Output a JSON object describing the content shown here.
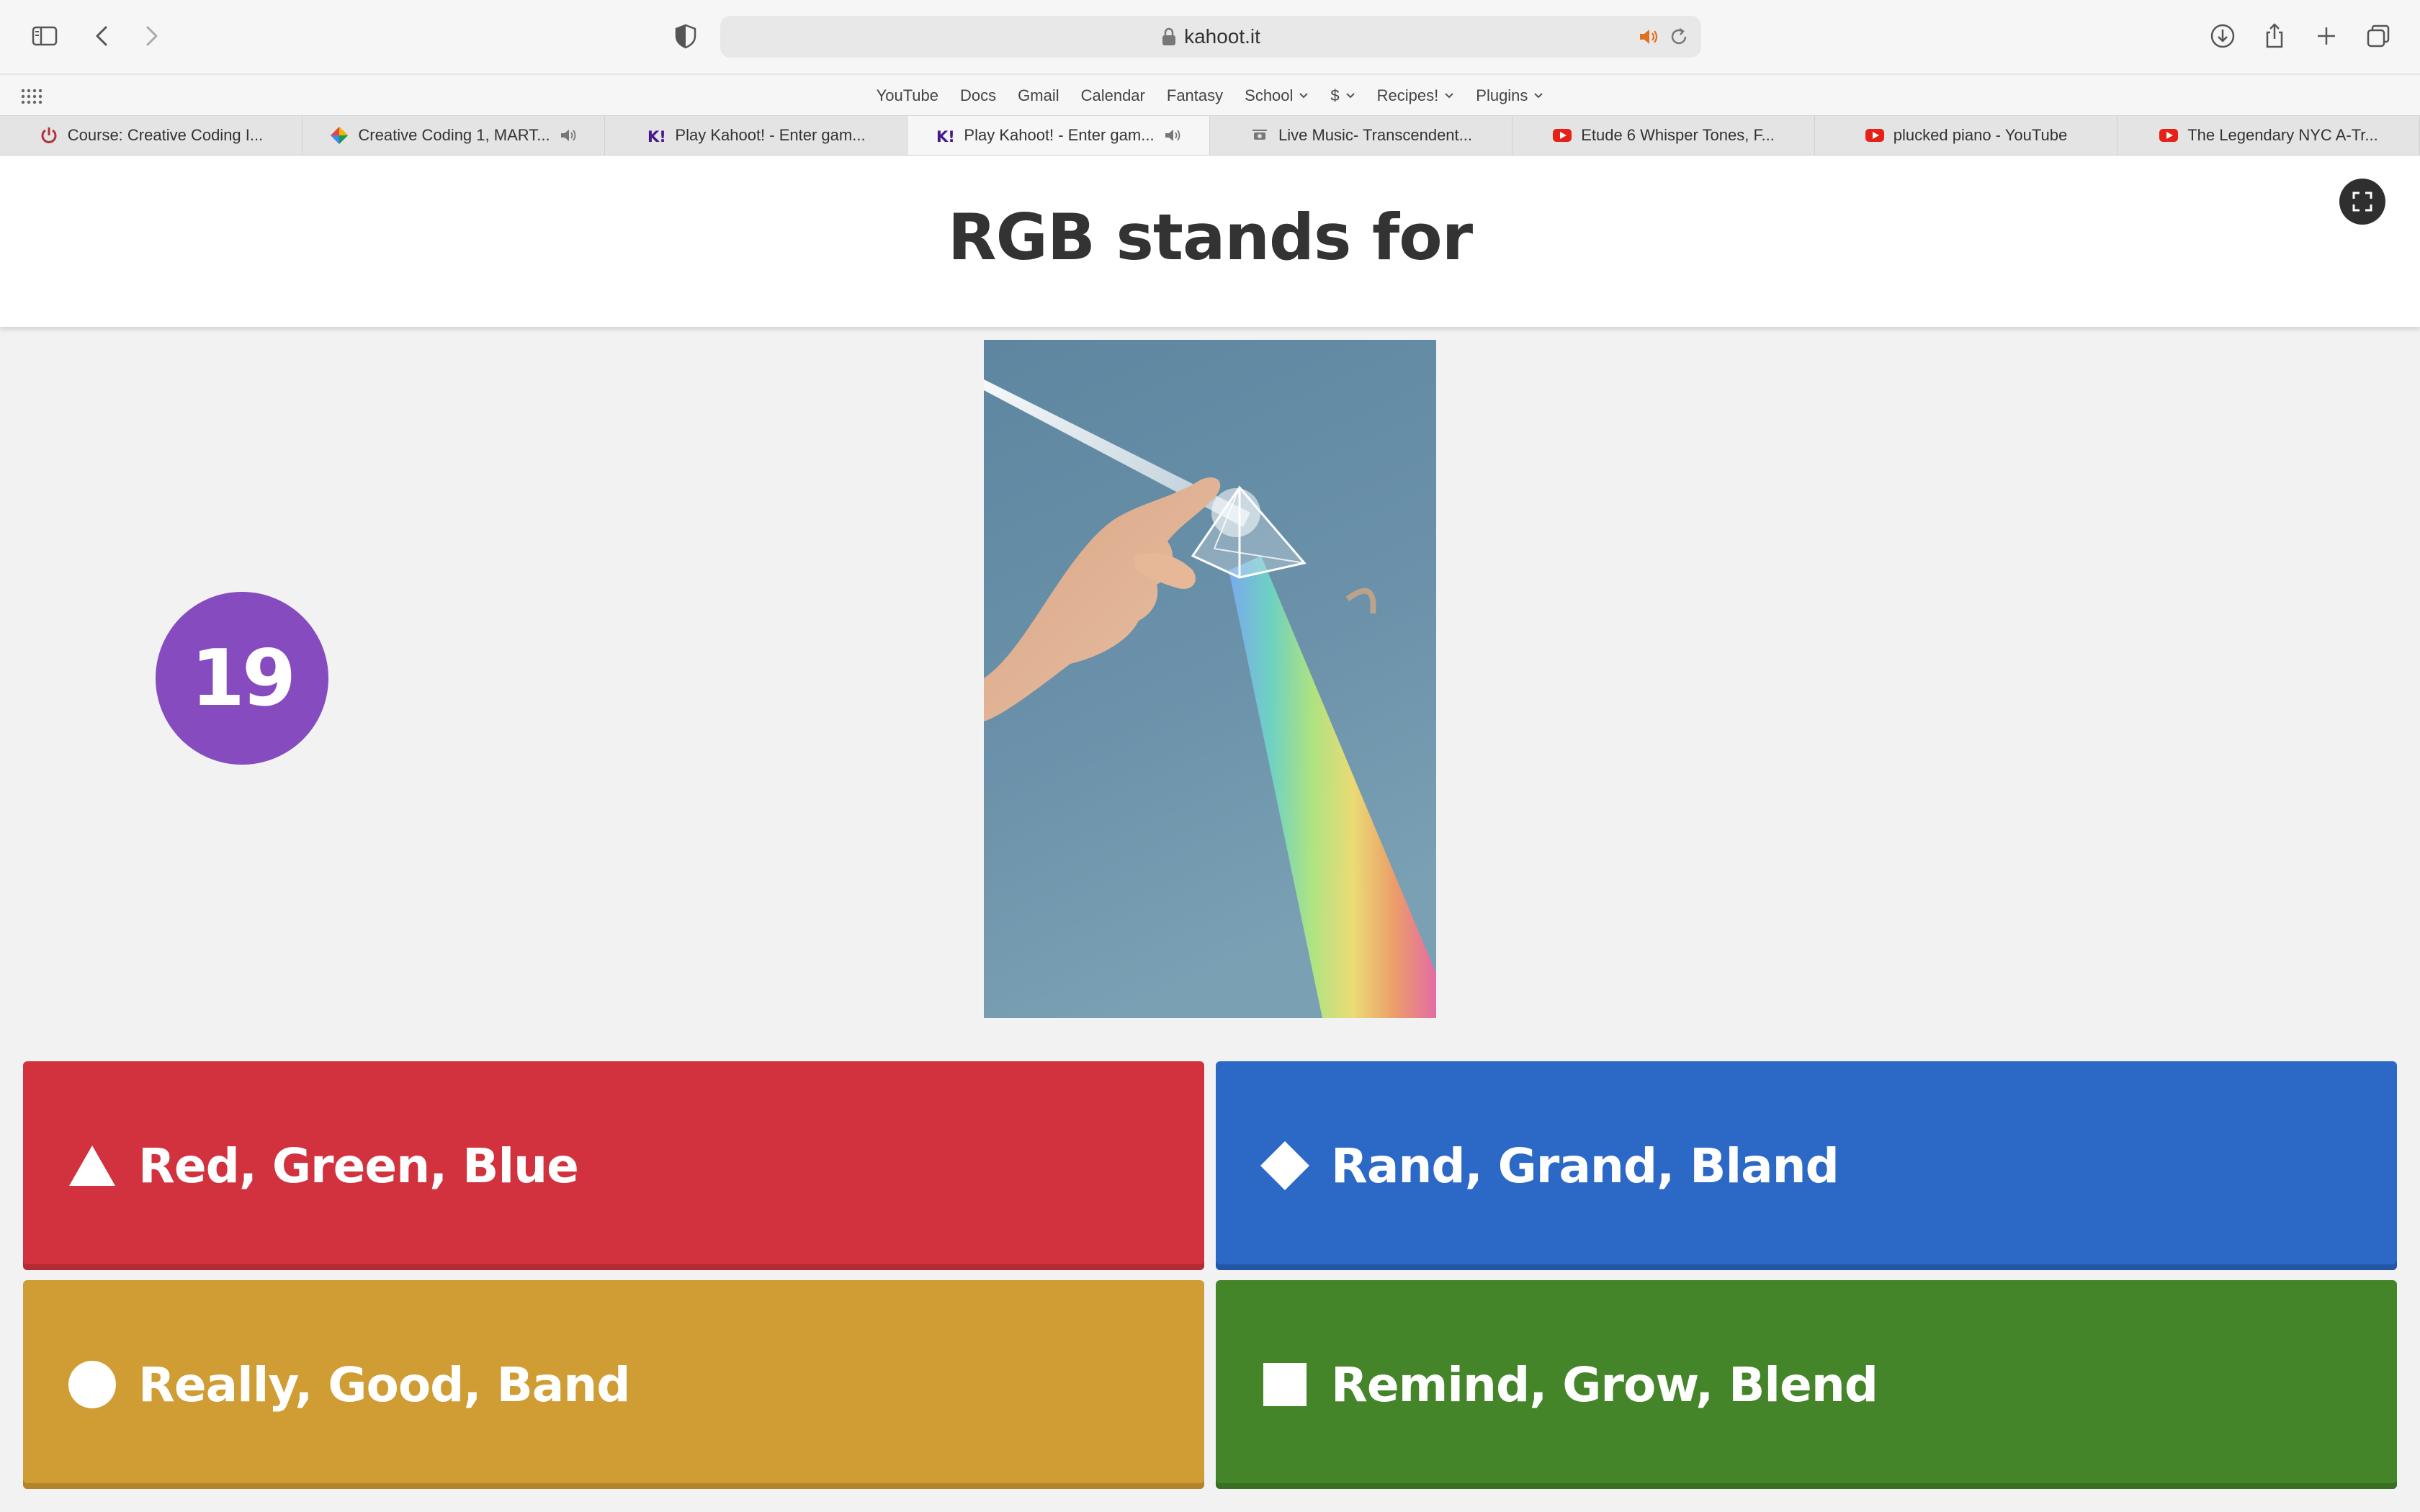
{
  "browser": {
    "address": "kahoot.it",
    "favorites": [
      {
        "label": "YouTube",
        "dropdown": false
      },
      {
        "label": "Docs",
        "dropdown": false
      },
      {
        "label": "Gmail",
        "dropdown": false
      },
      {
        "label": "Calendar",
        "dropdown": false
      },
      {
        "label": "Fantasy",
        "dropdown": false
      },
      {
        "label": "School",
        "dropdown": true
      },
      {
        "label": "$",
        "dropdown": true
      },
      {
        "label": "Recipes!",
        "dropdown": true
      },
      {
        "label": "Plugins",
        "dropdown": true
      }
    ],
    "tabs": [
      {
        "label": "Course: Creative Coding I...",
        "icon": "power-icon",
        "audio": false,
        "active": false
      },
      {
        "label": "Creative Coding 1, MART...",
        "icon": "colorful-diamond-icon",
        "audio": true,
        "active": false
      },
      {
        "label": "Play Kahoot! - Enter gam...",
        "icon": "kahoot-icon",
        "audio": false,
        "active": false
      },
      {
        "label": "Play Kahoot! - Enter gam...",
        "icon": "kahoot-icon",
        "audio": true,
        "active": true
      },
      {
        "label": "Live Music- Transcendent...",
        "icon": "music-icon",
        "audio": false,
        "active": false
      },
      {
        "label": "Etude 6 Whisper Tones, F...",
        "icon": "youtube-icon",
        "audio": false,
        "active": false
      },
      {
        "label": "plucked piano - YouTube",
        "icon": "youtube-icon",
        "audio": false,
        "active": false
      },
      {
        "label": "The Legendary NYC A-Tr...",
        "icon": "youtube-icon",
        "audio": false,
        "active": false
      }
    ]
  },
  "kahoot": {
    "question": "RGB stands for",
    "timer": "19",
    "image_description_icon": "prism-rainbow-image",
    "answers": [
      {
        "label": "Red, Green, Blue",
        "shape": "triangle-icon",
        "color": "#d1323e"
      },
      {
        "label": "Rand, Grand, Bland",
        "shape": "diamond-icon",
        "color": "#2c68c5"
      },
      {
        "label": "Really, Good, Band",
        "shape": "circle-icon",
        "color": "#d09c34"
      },
      {
        "label": "Remind, Grow, Blend",
        "shape": "square-icon",
        "color": "#45852a"
      }
    ]
  }
}
